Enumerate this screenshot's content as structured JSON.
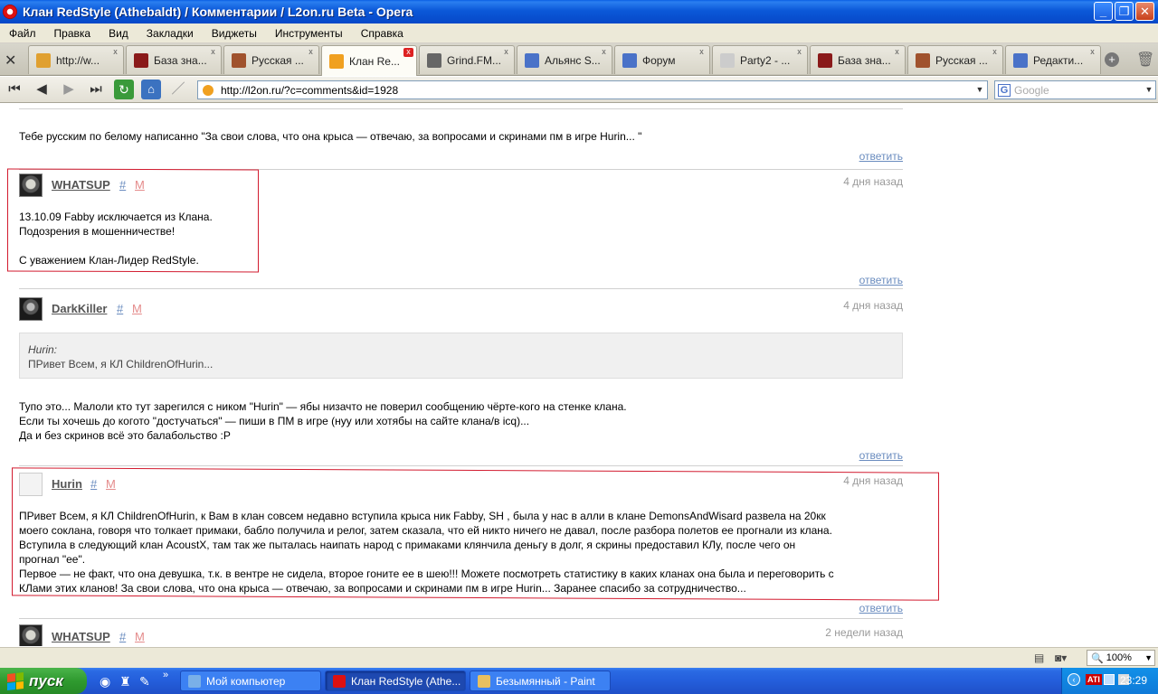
{
  "window": {
    "title": "Клан RedStyle (Athebaldt) / Комментарии / L2on.ru Beta - Opera",
    "buttons": {
      "minimize": "_",
      "maximize": "❐",
      "close": "✕"
    }
  },
  "menu": [
    "Файл",
    "Правка",
    "Вид",
    "Закладки",
    "Виджеты",
    "Инструменты",
    "Справка"
  ],
  "tabs": [
    {
      "label": "http://w...",
      "icon_color": "#e0a030"
    },
    {
      "label": "База зна...",
      "icon_color": "#8a1a1a"
    },
    {
      "label": "Русская ...",
      "icon_color": "#a0522d"
    },
    {
      "label": "Клан Re...",
      "icon_color": "#f0a020",
      "active": true
    },
    {
      "label": "Grind.FM...",
      "icon_color": "#666"
    },
    {
      "label": "Альянс S...",
      "icon_color": "#4a72c8"
    },
    {
      "label": "Форум",
      "icon_color": "#4a72c8"
    },
    {
      "label": "Party2 - ...",
      "icon_color": "#ccc"
    },
    {
      "label": "База зна...",
      "icon_color": "#8a1a1a"
    },
    {
      "label": "Русская ...",
      "icon_color": "#a0522d"
    },
    {
      "label": "Редакти...",
      "icon_color": "#4a72c8"
    }
  ],
  "addressbar": {
    "url": "http://l2on.ru/?c=comments&id=1928",
    "search_placeholder": "Google"
  },
  "comments": {
    "top_text": "Тебе русским по белому написанно \"За свои слова, что она крыса — отвечаю, за вопросами и скринами пм в игре Hurin... \"",
    "reply_label": "ответить",
    "hash": "#",
    "m": "M",
    "c1": {
      "user": "WHATSUP",
      "ago": "4 дня назад",
      "lines": [
        "13.10.09 Fabby исключается из Клана.",
        "Подозрения в мошенничестве!",
        "",
        "С уважением Клан-Лидер RedStyle."
      ]
    },
    "c2": {
      "user": "DarkKiller",
      "ago": "4 дня назад",
      "quote_author": "Hurin:",
      "quote_text": "ПРивет Всем, я КЛ ChildrenOfHurin...",
      "lines": [
        "Тупо это... Малоли кто тут зарегился с ником \"Hurin\" — ябы низачто не поверил сообщению чёрте-кого на стенке клана.",
        "Если ты хочешь до когото \"достучаться\" — пиши в ПМ в игре (нуу или хотябы на сайте клана/в icq)...",
        "Да и без скринов всё это балабольство :P"
      ]
    },
    "c3": {
      "user": "Hurin",
      "ago": "4 дня назад",
      "lines": [
        "ПРивет Всем, я КЛ ChildrenOfHurin, к Вам в клан совсем недавно вступила крыса ник Fabby, SH , была у нас в алли в клане DemonsAndWisard развела на 20кк",
        "моего соклана, говоря что толкает примаки, бабло получила и релог, затем сказала, что ей никто ничего не давал, после разбора полетов ее прогнали из клана.",
        "Вступила в следующий клан AcoustX, там так же пыталась наипать народ с примаками клянчила деньгу в долг, я скрины предоставил КЛу, после чего он",
        "прогнал \"ее\".",
        "Первое — не факт, что она девушка, т.к. в вентре не сидела, второе гоните ее в шею!!! Можете посмотреть статистику в каких кланах она была и переговорить с",
        "КЛами этих кланов! За свои слова, что она крыса  — отвечаю, за вопросами и скринами пм в игре Hurin... Заранее спасибо за сотрудничество..."
      ]
    },
    "c4": {
      "user": "WHATSUP",
      "ago": "2 недели назад"
    }
  },
  "statusbar": {
    "zoom": "100%"
  },
  "taskbar": {
    "start": "пуск",
    "tasks": [
      {
        "label": "Мой компьютер",
        "icon_color": "#7ab0e8"
      },
      {
        "label": "Клан RedStyle (Athe...",
        "icon_color": "#d11",
        "active": true
      },
      {
        "label": "Безымянный - Paint",
        "icon_color": "#e8c060"
      }
    ],
    "clock": "23:29",
    "tray_ati": "ATI"
  }
}
